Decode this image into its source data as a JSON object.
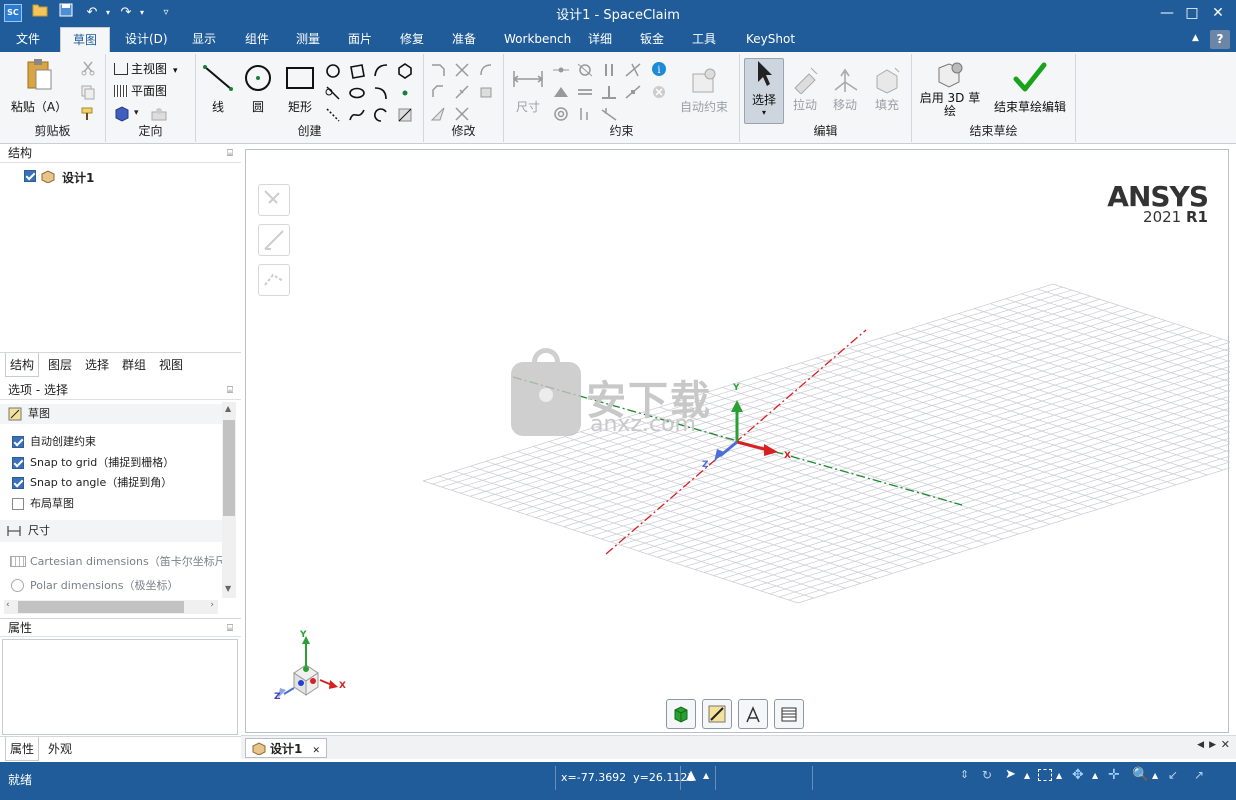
{
  "window": {
    "title": "设计1 - SpaceClaim",
    "logo": "SC",
    "minimize": "—",
    "maximize": "□",
    "close": "✕"
  },
  "quick_access": {
    "open_icon": "folder-icon",
    "save_icon": "save-icon",
    "undo": "↶",
    "redo": "↷",
    "more": "▿"
  },
  "menu": {
    "items": [
      "文件",
      "草图",
      "设计(D)",
      "显示",
      "组件",
      "测量",
      "面片",
      "修复",
      "准备",
      "Workbench",
      "详细",
      "钣金",
      "工具",
      "KeyShot"
    ],
    "active": "草图",
    "help": "?",
    "collapse": "▲"
  },
  "ribbon": {
    "clipboard": {
      "label": "剪贴板",
      "paste": "粘贴（A）"
    },
    "orient": {
      "label": "定向",
      "home": "主视图",
      "plan": "平面图"
    },
    "create": {
      "label": "创建",
      "line": "线",
      "circle": "圆",
      "rect": "矩形"
    },
    "modify": {
      "label": "修改"
    },
    "constraint": {
      "label": "约束",
      "dimension": "尺寸",
      "auto": "自动约束"
    },
    "edit": {
      "label": "编辑",
      "select": "选择",
      "pull": "拉动",
      "move": "移动",
      "fill": "填充"
    },
    "end_sketch": {
      "label": "结束草绘",
      "enable3d": "启用 3D 草绘",
      "end": "结束草绘编辑"
    }
  },
  "structure": {
    "title": "结构",
    "pin": "⌸",
    "root": "设计1"
  },
  "left_tabs": [
    "结构",
    "图层",
    "选择",
    "群组",
    "视图"
  ],
  "options": {
    "title": "选项 - 选择",
    "section_sketch": "草图",
    "items": [
      {
        "label": "自动创建约束",
        "checked": true
      },
      {
        "label": "Snap to grid（捕捉到栅格）",
        "checked": true
      },
      {
        "label": "Snap to angle（捕捉到角）",
        "checked": true
      },
      {
        "label": "布局草图",
        "checked": false
      }
    ],
    "section_dim": "尺寸",
    "dim_items": [
      "Cartesian dimensions（笛卡尔坐标尺寸",
      "Polar dimensions（极坐标）"
    ]
  },
  "properties": {
    "title": "属性",
    "tabs": [
      "属性",
      "外观"
    ]
  },
  "viewport": {
    "brand": "ANSYS",
    "version": "2021",
    "release": "R1",
    "axes": {
      "x": "X",
      "y": "Y",
      "z": "Z"
    },
    "watermark_text": "安下载",
    "watermark_sub": "anxz.com"
  },
  "doc_tab": {
    "label": "设计1",
    "close": "✕"
  },
  "status": {
    "text": "就绪",
    "coords": "x=-77.3692  y=26.1121"
  }
}
